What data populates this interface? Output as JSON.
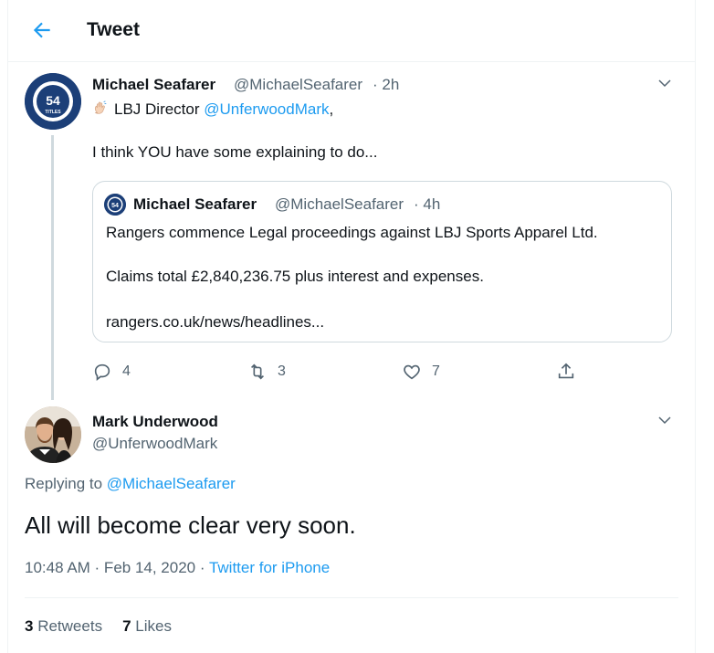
{
  "header": {
    "title": "Tweet",
    "back_icon": "arrow-left-icon"
  },
  "colors": {
    "accent": "#1d9bf0",
    "text": "#0f1419",
    "muted": "#536471",
    "border": "#cfd9de"
  },
  "tweet": {
    "author_name": "Michael Seafarer",
    "author_handle": "@MichaelSeafarer",
    "time": "· 2h",
    "avatar_text": "54",
    "avatar_sub": "TITLES",
    "line1_prefix": "LBJ Director ",
    "line1_mention": "@UnferwoodMark",
    "line1_suffix": ",",
    "line2": "I think YOU have some explaining to do...",
    "quote": {
      "author_name": "Michael Seafarer",
      "author_handle": "@MichaelSeafarer",
      "time": "· 4h",
      "avatar_text": "54",
      "line1": "Rangers commence Legal proceedings against LBJ Sports Apparel Ltd.",
      "line2": "Claims total £2,840,236.75 plus interest and expenses.",
      "line3": "rangers.co.uk/news/headlines..."
    },
    "actions": {
      "replies": "4",
      "retweets": "3",
      "likes": "7"
    }
  },
  "reply": {
    "author_name": "Mark Underwood",
    "author_handle": "@UnferwoodMark",
    "replying_label": "Replying to ",
    "replying_handle": "@MichaelSeafarer",
    "text": "All will become clear very soon.",
    "timestamp": "10:48 AM · Feb 14, 2020 · ",
    "source": "Twitter for iPhone",
    "retweets_count": "3",
    "retweets_label": "Retweets",
    "likes_count": "7",
    "likes_label": "Likes"
  }
}
